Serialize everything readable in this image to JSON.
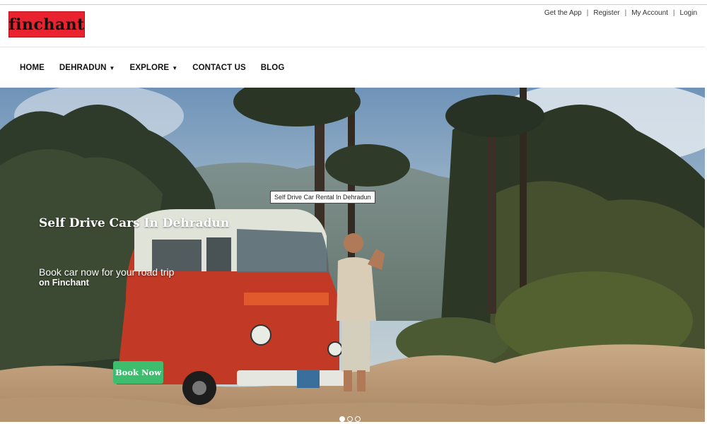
{
  "brand": {
    "logo_text": "finchant",
    "logo_bg": "#e8232f"
  },
  "top_links": [
    {
      "label": "Get the App"
    },
    {
      "label": "Register"
    },
    {
      "label": "My Account"
    },
    {
      "label": "Login"
    }
  ],
  "nav": {
    "home": "HOME",
    "city": "DEHRADUN",
    "explore": "EXPLORE",
    "contact": "CONTACT US",
    "blog": "BLOG"
  },
  "hero": {
    "image_tooltip": "Self Drive Car Rental In Dehradun",
    "title": "Self Drive Cars In Dehradun",
    "subtitle": "Book car now for your road trip",
    "subtitle2": "on Finchant",
    "cta_label": "Book Now",
    "cta_color": "#3fbd6f",
    "slides_total": 3,
    "slide_active": 1
  }
}
